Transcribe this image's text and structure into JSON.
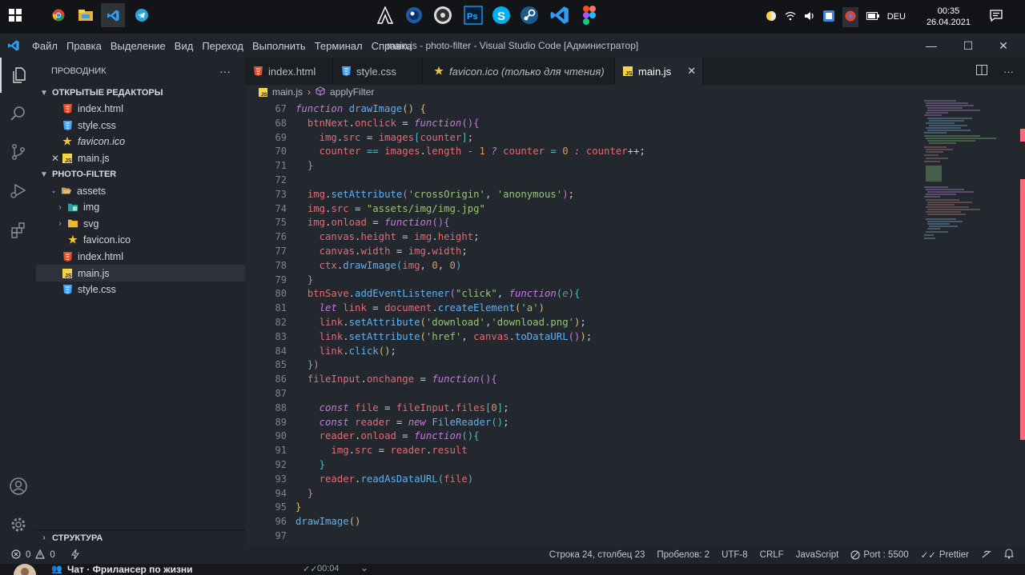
{
  "window": {
    "title": "main.js - photo-filter - Visual Studio Code [Администратор]"
  },
  "menu": [
    "Файл",
    "Правка",
    "Выделение",
    "Вид",
    "Переход",
    "Выполнить",
    "Терминал",
    "Справка"
  ],
  "taskbar": {
    "lang": "DEU",
    "time": "00:35",
    "date": "26.04.2021"
  },
  "sidebar": {
    "title": "ПРОВОДНИК",
    "more": "···",
    "open_editors_label": "ОТКРЫТЫЕ РЕДАКТОРЫ",
    "open_editors": [
      {
        "name": "index.html",
        "icon": "html-file-icon"
      },
      {
        "name": "style.css",
        "icon": "css-file-icon"
      },
      {
        "name": "favicon.ico",
        "icon": "star-icon"
      },
      {
        "name": "main.js",
        "icon": "js-file-icon"
      }
    ],
    "project_label": "PHOTO-FILTER",
    "tree": [
      {
        "name": "assets",
        "kind": "folder-open"
      },
      {
        "name": "img",
        "kind": "folder"
      },
      {
        "name": "svg",
        "kind": "folder"
      },
      {
        "name": "favicon.ico",
        "kind": "star"
      },
      {
        "name": "index.html",
        "kind": "html"
      },
      {
        "name": "main.js",
        "kind": "js"
      },
      {
        "name": "style.css",
        "kind": "css"
      }
    ],
    "outline_label": "СТРУКТУРА"
  },
  "tabs": [
    {
      "label": "index.html"
    },
    {
      "label": "style.css"
    },
    {
      "label": "favicon.ico (только для чтения)"
    },
    {
      "label": "main.js"
    }
  ],
  "breadcrumb": {
    "file": "main.js",
    "symbol": "applyFilter"
  },
  "editor": {
    "line_numbers": [
      "67",
      "68",
      "69",
      "70",
      "71",
      "72",
      "73",
      "74",
      "75",
      "76",
      "77",
      "78",
      "79",
      "80",
      "81",
      "82",
      "83",
      "84",
      "85",
      "86",
      "87",
      "88",
      "89",
      "90",
      "91",
      "92",
      "93",
      "94",
      "95",
      "96",
      "97"
    ]
  },
  "status": {
    "errors": "0",
    "warnings": "0",
    "position": "Строка 24, столбец 23",
    "spaces": "Пробелов: 2",
    "encoding": "UTF-8",
    "eol": "CRLF",
    "language": "JavaScript",
    "port": "Port : 5500",
    "prettier": "Prettier"
  },
  "bottom": {
    "chat": "Чат · Фрилансер по жизни",
    "time": "00:04"
  }
}
